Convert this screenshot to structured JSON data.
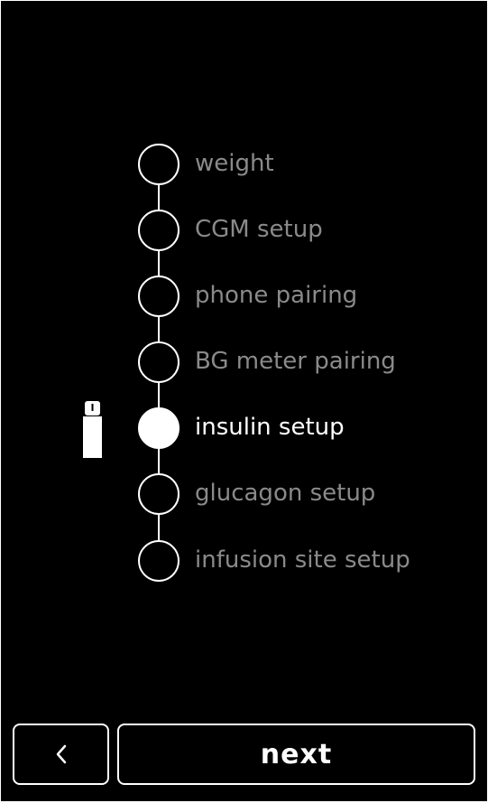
{
  "steps": [
    {
      "label": "weight",
      "state": "pending"
    },
    {
      "label": "CGM setup",
      "state": "pending"
    },
    {
      "label": "phone pairing",
      "state": "pending"
    },
    {
      "label": "BG meter pairing",
      "state": "pending"
    },
    {
      "label": "insulin setup",
      "state": "active"
    },
    {
      "label": "glucagon setup",
      "state": "pending"
    },
    {
      "label": "infusion site setup",
      "state": "pending"
    }
  ],
  "current_step_icon": "insulin-vial-icon",
  "footer": {
    "back_icon": "chevron-left-icon",
    "next_label": "next"
  },
  "colors": {
    "background": "#000000",
    "foreground": "#ffffff",
    "inactive_text": "#8a8a8a"
  }
}
